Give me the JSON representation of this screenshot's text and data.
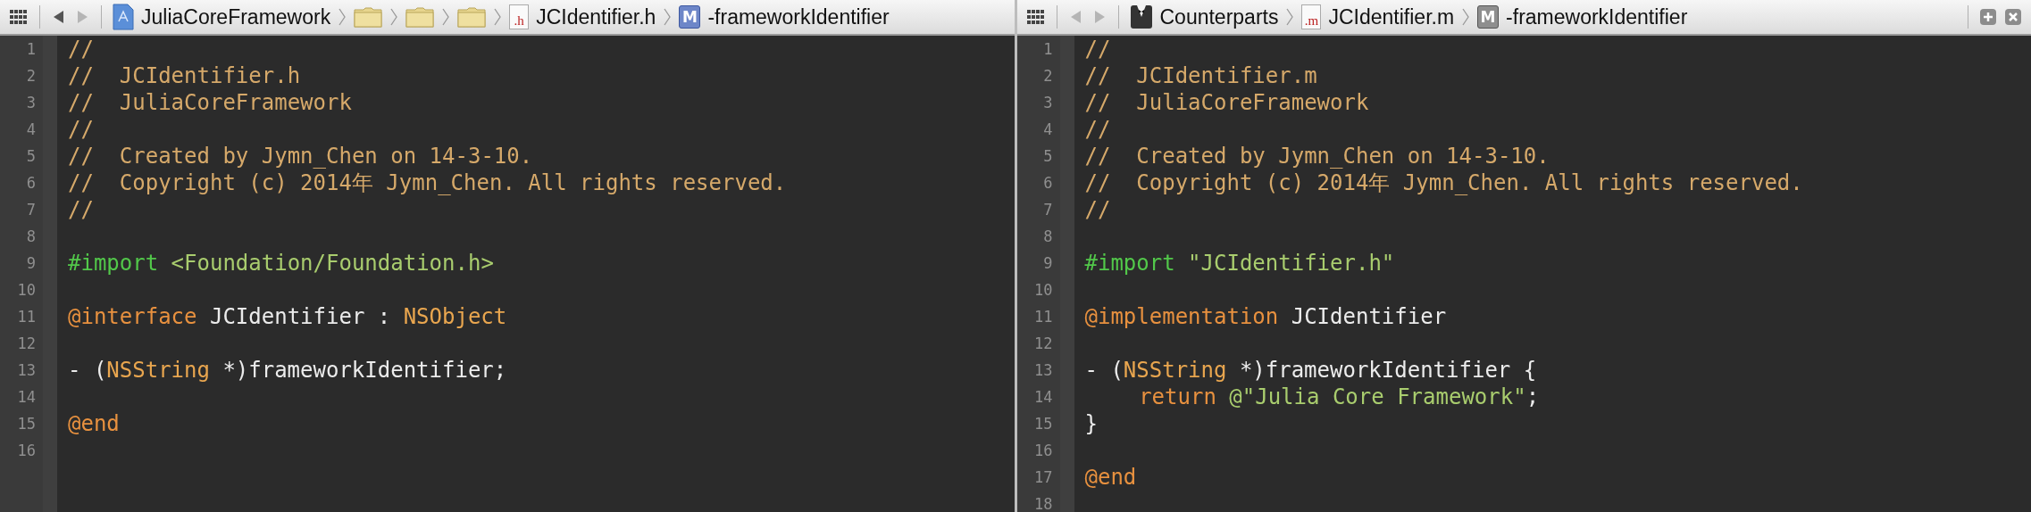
{
  "editors": [
    {
      "jump_bar": {
        "back_disabled": false,
        "forward_disabled": true,
        "crumbs": [
          {
            "kind": "project",
            "label": "JuliaCoreFramework"
          },
          {
            "kind": "folder"
          },
          {
            "kind": "folder"
          },
          {
            "kind": "folder"
          },
          {
            "kind": "file",
            "badge": ".h",
            "label": "JCIdentifier.h"
          },
          {
            "kind": "method",
            "badge": "M",
            "label": "-frameworkIdentifier"
          }
        ]
      },
      "lines": [
        {
          "number": "1",
          "tokens": [
            {
              "kind": "comment",
              "text": "//"
            }
          ]
        },
        {
          "number": "2",
          "tokens": [
            {
              "kind": "comment",
              "text": "//  JCIdentifier.h"
            }
          ]
        },
        {
          "number": "3",
          "tokens": [
            {
              "kind": "comment",
              "text": "//  JuliaCoreFramework"
            }
          ]
        },
        {
          "number": "4",
          "tokens": [
            {
              "kind": "comment",
              "text": "//"
            }
          ]
        },
        {
          "number": "5",
          "tokens": [
            {
              "kind": "comment",
              "text": "//  Created by Jymn_Chen on 14-3-10."
            }
          ]
        },
        {
          "number": "6",
          "tokens": [
            {
              "kind": "comment",
              "text": "//  Copyright (c) 2014年 Jymn_Chen. All rights reserved."
            }
          ]
        },
        {
          "number": "7",
          "tokens": [
            {
              "kind": "comment",
              "text": "//"
            }
          ]
        },
        {
          "number": "8"
        },
        {
          "number": "9",
          "tokens": [
            {
              "kind": "preprocessor",
              "text": "#import"
            },
            {
              "kind": "string",
              "text": "<Foundation/Foundation.h>"
            }
          ]
        },
        {
          "number": "10"
        },
        {
          "number": "11",
          "tokens": [
            {
              "kind": "keyword",
              "text": "@interface"
            },
            {
              "kind": "plain",
              "text": "JCIdentifier"
            },
            {
              "kind": "plain",
              "text": ":"
            },
            {
              "kind": "type",
              "text": "NSObject"
            }
          ]
        },
        {
          "number": "12"
        },
        {
          "number": "13",
          "tokens": [
            {
              "kind": "plain",
              "text": "-"
            },
            {
              "kind": "plain",
              "text": "("
            },
            {
              "kind": "type",
              "text": "NSString"
            },
            {
              "kind": "plain",
              "text": "*)frameworkIdentifier;"
            }
          ]
        },
        {
          "number": "14"
        },
        {
          "number": "15",
          "tokens": [
            {
              "kind": "keyword",
              "text": "@end"
            }
          ]
        },
        {
          "number": "16"
        }
      ]
    },
    {
      "jump_bar": {
        "back_disabled": true,
        "forward_disabled": true,
        "crumbs": [
          {
            "kind": "counterparts",
            "label": "Counterparts"
          },
          {
            "kind": "file",
            "badge": ".m",
            "label": "JCIdentifier.m"
          },
          {
            "kind": "method",
            "badge": "M",
            "label": "-frameworkIdentifier"
          }
        ]
      },
      "lines": [
        {
          "number": "1",
          "tokens": [
            {
              "kind": "comment",
              "text": "//"
            }
          ]
        },
        {
          "number": "2",
          "tokens": [
            {
              "kind": "comment",
              "text": "//  JCIdentifier.m"
            }
          ]
        },
        {
          "number": "3",
          "tokens": [
            {
              "kind": "comment",
              "text": "//  JuliaCoreFramework"
            }
          ]
        },
        {
          "number": "4",
          "tokens": [
            {
              "kind": "comment",
              "text": "//"
            }
          ]
        },
        {
          "number": "5",
          "tokens": [
            {
              "kind": "comment",
              "text": "//  Created by Jymn_Chen on 14-3-10."
            }
          ]
        },
        {
          "number": "6",
          "tokens": [
            {
              "kind": "comment",
              "text": "//  Copyright (c) 2014年 Jymn_Chen. All rights reserved."
            }
          ]
        },
        {
          "number": "7",
          "tokens": [
            {
              "kind": "comment",
              "text": "//"
            }
          ]
        },
        {
          "number": "8"
        },
        {
          "number": "9",
          "tokens": [
            {
              "kind": "preprocessor",
              "text": "#import"
            },
            {
              "kind": "string",
              "text": "\"JCIdentifier.h\""
            }
          ]
        },
        {
          "number": "10"
        },
        {
          "number": "11",
          "tokens": [
            {
              "kind": "keyword",
              "text": "@implementation"
            },
            {
              "kind": "plain",
              "text": "JCIdentifier"
            }
          ]
        },
        {
          "number": "12"
        },
        {
          "number": "13",
          "tokens": [
            {
              "kind": "plain",
              "text": "-"
            },
            {
              "kind": "plain",
              "text": "("
            },
            {
              "kind": "type",
              "text": "NSString"
            },
            {
              "kind": "plain",
              "text": "*)frameworkIdentifier"
            },
            {
              "kind": "plain",
              "text": "{"
            }
          ]
        },
        {
          "number": "14",
          "indented": true,
          "tokens": [
            {
              "kind": "keyword",
              "text": "return"
            },
            {
              "kind": "string",
              "text": "@\"Julia Core Framework\""
            },
            {
              "kind": "plain",
              "text": ";"
            }
          ]
        },
        {
          "number": "15",
          "tokens": [
            {
              "kind": "plain",
              "text": "}"
            }
          ]
        },
        {
          "number": "16"
        },
        {
          "number": "17",
          "tokens": [
            {
              "kind": "keyword",
              "text": "@end"
            }
          ]
        },
        {
          "number": "18"
        }
      ],
      "controls": [
        {
          "kind": "add"
        },
        {
          "kind": "close"
        }
      ]
    }
  ]
}
